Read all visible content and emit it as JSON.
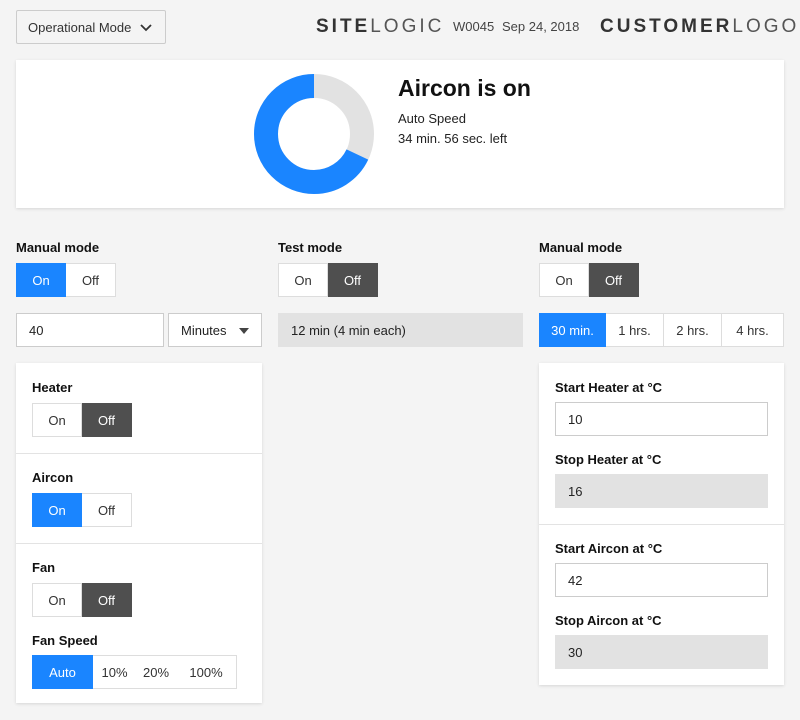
{
  "header": {
    "mode_select": "Operational Mode",
    "brand_bold": "SITE",
    "brand_light": "LOGIC",
    "site_id": "W0045",
    "date": "Sep 24, 2018",
    "customer_bold": "CUSTOMER",
    "customer_light": "LOGO"
  },
  "status": {
    "title": "Aircon is on",
    "speed": "Auto Speed",
    "remaining": "34 min. 56 sec. left",
    "progress_fraction": 0.68,
    "colors": {
      "progress": "#1a85ff",
      "track": "#e2e2e2"
    }
  },
  "col1": {
    "label": "Manual mode",
    "on": "On",
    "off": "Off",
    "duration_value": "40",
    "unit": "Minutes"
  },
  "col2": {
    "label": "Test mode",
    "on": "On",
    "off": "Off",
    "duration_text": "12 min (4 min each)"
  },
  "col3": {
    "label": "Manual mode",
    "on": "On",
    "off": "Off",
    "times": [
      "30 min.",
      "1 hrs.",
      "2 hrs.",
      "4 hrs."
    ]
  },
  "devices": {
    "heater": {
      "label": "Heater",
      "on": "On",
      "off": "Off"
    },
    "aircon": {
      "label": "Aircon",
      "on": "On",
      "off": "Off"
    },
    "fan": {
      "label": "Fan",
      "on": "On",
      "off": "Off"
    },
    "fan_speed": {
      "label": "Fan Speed",
      "options": [
        "Auto",
        "10%",
        "20%",
        "100%"
      ]
    }
  },
  "thresholds": {
    "start_heater_label": "Start Heater at °C",
    "start_heater_value": "10",
    "stop_heater_label": "Stop Heater at °C",
    "stop_heater_value": "16",
    "start_aircon_label": "Start Aircon at °C",
    "start_aircon_value": "42",
    "stop_aircon_label": "Stop Aircon at °C",
    "stop_aircon_value": "30"
  }
}
